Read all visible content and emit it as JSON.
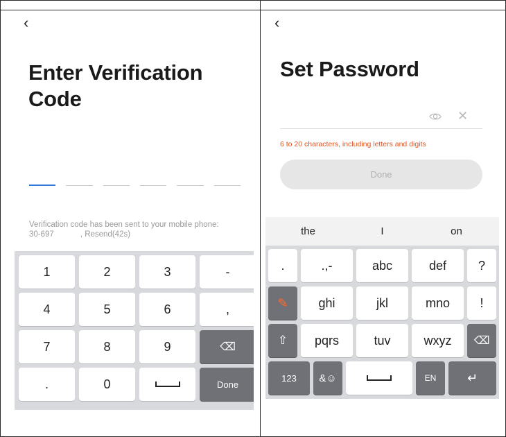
{
  "left_screen": {
    "back_glyph": "‹",
    "title_line1": "Enter Verification",
    "title_line2": "Code",
    "code_slot_count": 6,
    "info_line1": "Verification code has been sent to your mobile phone:",
    "info_line2_phone": "30-697",
    "info_line2_resend": ", Resend(42s)",
    "keypad": {
      "rows": [
        [
          "1",
          "2",
          "3",
          "-"
        ],
        [
          "4",
          "5",
          "6",
          ","
        ],
        [
          "7",
          "8",
          "9",
          "⌫"
        ],
        [
          ".",
          "0",
          "space",
          "Done"
        ]
      ]
    }
  },
  "right_screen": {
    "back_glyph": "‹",
    "title": "Set Password",
    "password_value": "",
    "eye_icon": "eye-icon",
    "clear_glyph": "✕",
    "hint": "6 to 20 characters, including letters and digits",
    "hint_color": "#e2531f",
    "done_label": "Done",
    "suggestions": [
      "the",
      "I",
      "on"
    ],
    "keyboard": {
      "row1": [
        ".",
        ".,-",
        "abc",
        "def",
        "?"
      ],
      "row2": [
        "✎",
        "ghi",
        "jkl",
        "mno",
        "!"
      ],
      "row3": [
        "⇧",
        "pqrs",
        "tuv",
        "wxyz",
        "⌫"
      ],
      "row4": [
        "123",
        "&☺",
        "space",
        "EN",
        "↵"
      ]
    }
  }
}
